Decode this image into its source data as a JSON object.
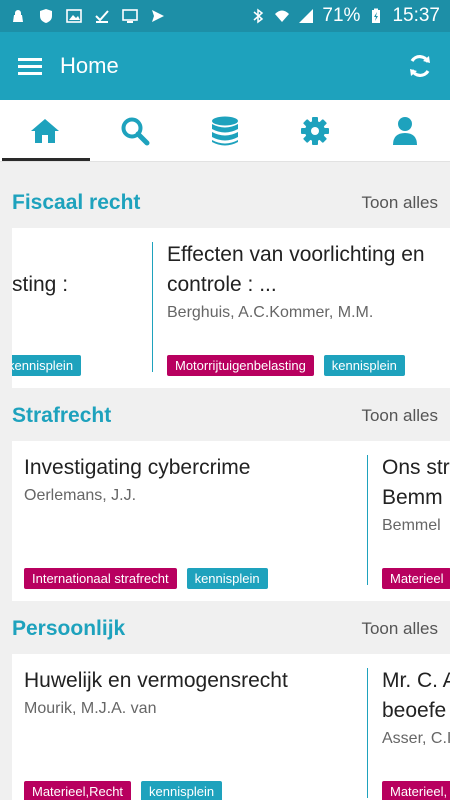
{
  "status_bar": {
    "battery": "71%",
    "time": "15:37"
  },
  "app_bar": {
    "title": "Home"
  },
  "tabs": [
    {
      "name": "home",
      "icon": "home-icon"
    },
    {
      "name": "search",
      "icon": "search-icon"
    },
    {
      "name": "database",
      "icon": "database-icon"
    },
    {
      "name": "settings",
      "icon": "gear-icon"
    },
    {
      "name": "profile",
      "icon": "user-icon"
    }
  ],
  "sections": [
    {
      "title": "Fiscaal recht",
      "link": "Toon alles",
      "cards": [
        {
          "title_lines": [
            "sting :",
            ""
          ],
          "authors": "",
          "tags": [
            {
              "label": "kennisplein",
              "color": "teal"
            }
          ]
        },
        {
          "title_lines": [
            "Effecten van voorlichting en",
            "controle : ..."
          ],
          "authors": "Berghuis, A.C.Kommer, M.M.",
          "tags": [
            {
              "label": "Motorrijtuigenbelasting",
              "color": "magenta"
            },
            {
              "label": "kennisplein",
              "color": "teal"
            }
          ]
        }
      ]
    },
    {
      "title": "Strafrecht",
      "link": "Toon alles",
      "cards": [
        {
          "title_lines": [
            "Investigating cybercrime"
          ],
          "authors": "Oerlemans, J.J.",
          "tags": [
            {
              "label": "Internationaal strafrecht",
              "color": "magenta"
            },
            {
              "label": "kennisplein",
              "color": "teal"
            }
          ]
        },
        {
          "title_lines": [
            "Ons str",
            "Bemm"
          ],
          "authors": "Bemmel",
          "tags": [
            {
              "label": "Materieel",
              "color": "magenta"
            }
          ]
        }
      ]
    },
    {
      "title": "Persoonlijk",
      "link": "Toon alles",
      "cards": [
        {
          "title_lines": [
            "Huwelijk en vermogensrecht"
          ],
          "authors": "Mourik, M.J.A. van",
          "tags": [
            {
              "label": "Materieel,Recht",
              "color": "magenta"
            },
            {
              "label": "kennisplein",
              "color": "teal"
            }
          ]
        },
        {
          "title_lines": [
            "Mr. C. A",
            "beoefe"
          ],
          "authors": "Asser, C.I",
          "tags": [
            {
              "label": "Materieel,",
              "color": "magenta"
            }
          ]
        }
      ]
    }
  ]
}
